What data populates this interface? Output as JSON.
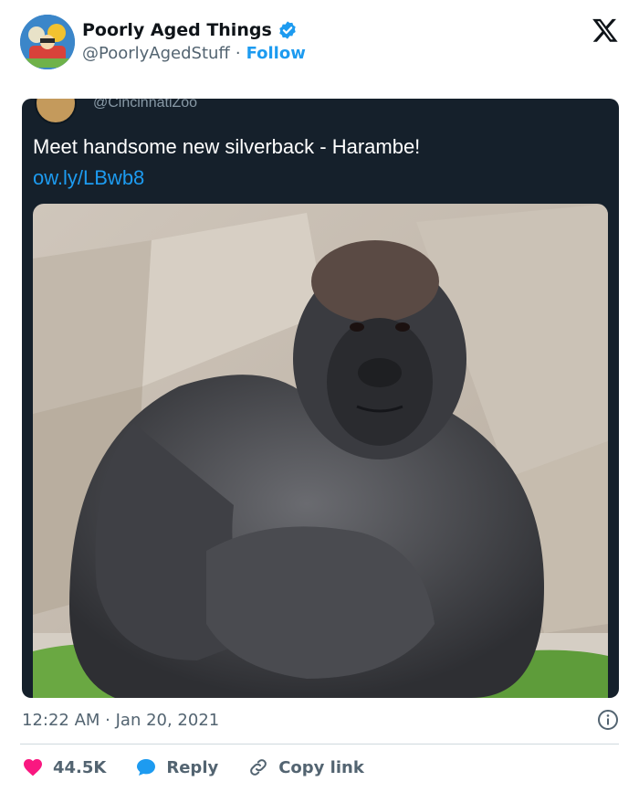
{
  "header": {
    "display_name": "Poorly Aged Things",
    "handle": "@PoorlyAgedStuff",
    "separator": "·",
    "follow_label": "Follow"
  },
  "embedded_tweet": {
    "handle": "@CincinnatiZoo",
    "text": "Meet handsome new silverback - Harambe!",
    "link": "ow.ly/LBwb8"
  },
  "footer": {
    "timestamp": "12:22 AM · Jan 20, 2021",
    "likes": "44.5K",
    "reply_label": "Reply",
    "copy_link_label": "Copy link"
  },
  "colors": {
    "accent": "#1d9bf0",
    "like": "#f91880",
    "embed_bg": "#15202b"
  },
  "icons": [
    "x-logo-icon",
    "verified-badge-icon",
    "info-icon",
    "heart-icon",
    "reply-bubble-icon",
    "link-icon"
  ]
}
